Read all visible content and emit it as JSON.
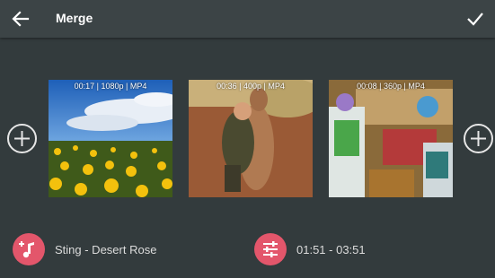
{
  "header": {
    "title": "Merge",
    "back_icon": "arrow-left-icon",
    "confirm_icon": "check-icon"
  },
  "clips": [
    {
      "meta": "00:17 | 1080p | MP4",
      "scene": "dandelion field under blue sky"
    },
    {
      "meta": "00:36 | 400p | MP4",
      "scene": "person hugging kangaroo"
    },
    {
      "meta": "00:08 | 360p | MP4",
      "scene": "toy room with space ranger figures"
    }
  ],
  "add_icon": "plus-circle-icon",
  "music": {
    "label": "Sting - Desert Rose",
    "icon": "music-add-icon"
  },
  "trim": {
    "label": "01:51 - 03:51",
    "icon": "sliders-icon"
  },
  "colors": {
    "accent": "#e3566b",
    "background": "#333b3d",
    "toolbar": "#3c4446"
  }
}
